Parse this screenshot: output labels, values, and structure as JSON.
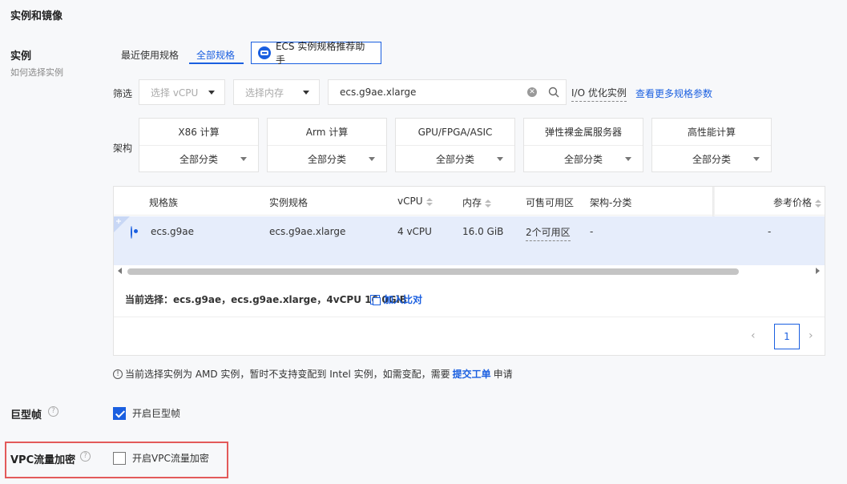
{
  "section_title": "实例和镜像",
  "instance": {
    "label": "实例",
    "sub_link": "如何选择实例",
    "tabs": [
      {
        "label": "最近使用规格",
        "active": false
      },
      {
        "label": "全部规格",
        "active": true
      }
    ],
    "assistant_button": "ECS 实例规格推荐助手"
  },
  "filter": {
    "label": "筛选",
    "vcpu_placeholder": "选择 vCPU",
    "memory_placeholder": "选择内存",
    "search_value": "ecs.g9ae.xlarge",
    "io_optimized": "I/O 优化实例",
    "more_params_link": "查看更多规格参数"
  },
  "arch": {
    "label": "架构",
    "cards": [
      {
        "title": "X86 计算",
        "select": "全部分类"
      },
      {
        "title": "Arm 计算",
        "select": "全部分类"
      },
      {
        "title": "GPU/FPGA/ASIC",
        "select": "全部分类"
      },
      {
        "title": "弹性裸金属服务器",
        "select": "全部分类"
      },
      {
        "title": "高性能计算",
        "select": "全部分类"
      }
    ]
  },
  "table": {
    "headers": {
      "family": "规格族",
      "spec": "实例规格",
      "vcpu": "vCPU",
      "memory": "内存",
      "zones": "可售可用区",
      "arch": "架构-分类",
      "price": "参考价格"
    },
    "rows": [
      {
        "family": "ecs.g9ae",
        "spec": "ecs.g9ae.xlarge",
        "vcpu": "4 vCPU",
        "memory": "16.0 GiB",
        "zones": "2个可用区",
        "arch": "-",
        "price": "-",
        "selected": true
      }
    ],
    "current_selection": "当前选择：ecs.g9ae，ecs.g9ae.xlarge，4vCPU 16.0GiB",
    "add_compare": "加入比对",
    "page": "1"
  },
  "notice": {
    "text": "当前选择实例为 AMD 实例，暂时不支持变配到 Intel 实例，如需变配，需要",
    "link": "提交工单",
    "suffix": "申请"
  },
  "jumbo": {
    "label": "巨型帧",
    "checkbox_label": "开启巨型帧",
    "checked": true
  },
  "vpc": {
    "label": "VPC流量加密",
    "checkbox_label": "开启VPC流量加密",
    "checked": false
  },
  "colors": {
    "accent": "#1a5fe0",
    "highlight": "#e35a5a",
    "selected_row": "#e6edfb"
  }
}
